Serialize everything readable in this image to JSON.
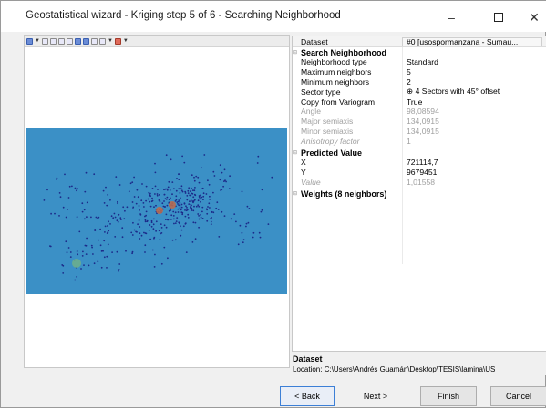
{
  "window": {
    "title": "Geostatistical wizard - Kriging step 5 of 6 - Searching Neighborhood"
  },
  "map": {
    "background_color": "#3b90c6",
    "point_color": "#1c2a8a"
  },
  "properties": {
    "header": {
      "key": "Dataset",
      "value": "#0 [usospormanzana - Sumau..."
    },
    "sections": [
      {
        "title": "Search Neighborhood",
        "rows": [
          {
            "key": "Neighborhood type",
            "value": "Standard"
          },
          {
            "key": "Maximum neighbors",
            "value": "5"
          },
          {
            "key": "Minimum neighbors",
            "value": "2"
          },
          {
            "key": "Sector type",
            "value": "⊕ 4 Sectors with 45° offset"
          },
          {
            "key": "Copy from Variogram",
            "value": "True"
          },
          {
            "key": "Angle",
            "value": "98,08594"
          },
          {
            "key": "Major semiaxis",
            "value": "134,0915"
          },
          {
            "key": "Minor semiaxis",
            "value": "134,0915"
          },
          {
            "key": "Anisotropy factor",
            "value": "1"
          }
        ]
      },
      {
        "title": "Predicted Value",
        "rows": [
          {
            "key": "X",
            "value": "721114,7"
          },
          {
            "key": "Y",
            "value": "9679451"
          },
          {
            "key": "Value",
            "value": "1,01558"
          }
        ]
      },
      {
        "title": "Weights (8 neighbors)",
        "rows": []
      }
    ]
  },
  "info": {
    "title": "Dataset",
    "text": "Location: C:\\Users\\Andrés Guamán\\Desktop\\TESIS\\lamina\\US"
  },
  "buttons": {
    "back": "< Back",
    "next": "Next >",
    "finish": "Finish",
    "cancel": "Cancel"
  }
}
